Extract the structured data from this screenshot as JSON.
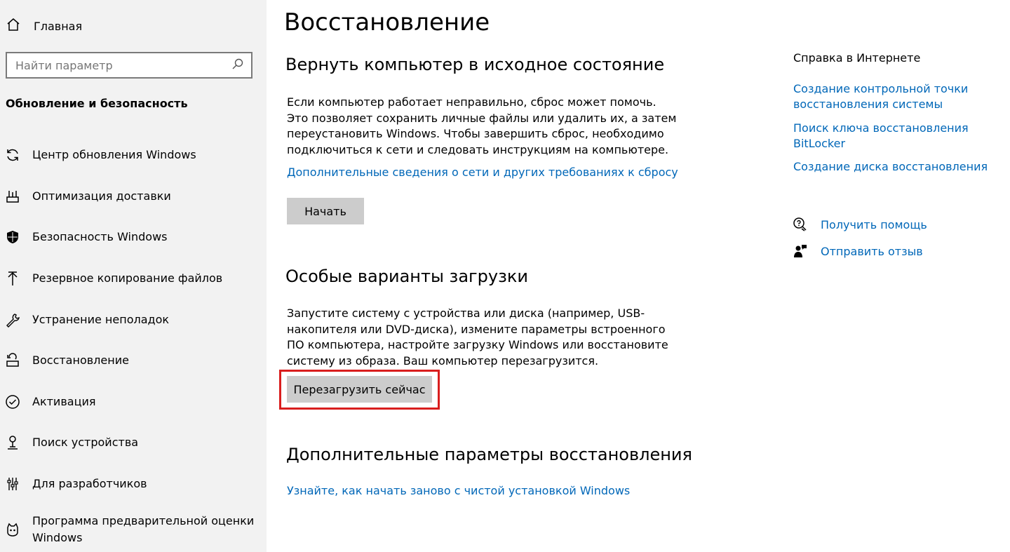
{
  "sidebar": {
    "home_label": "Главная",
    "search_placeholder": "Найти параметр",
    "section_title": "Обновление и безопасность",
    "items": [
      {
        "label": "Центр обновления Windows",
        "icon": "sync-icon"
      },
      {
        "label": "Оптимизация доставки",
        "icon": "delivery-icon"
      },
      {
        "label": "Безопасность Windows",
        "icon": "shield-icon"
      },
      {
        "label": "Резервное копирование файлов",
        "icon": "backup-arrow-icon"
      },
      {
        "label": "Устранение неполадок",
        "icon": "wrench-icon"
      },
      {
        "label": "Восстановление",
        "icon": "recovery-icon"
      },
      {
        "label": "Активация",
        "icon": "check-circle-icon"
      },
      {
        "label": "Поиск устройства",
        "icon": "person-pin-icon"
      },
      {
        "label": "Для разработчиков",
        "icon": "developer-icon"
      },
      {
        "label": "Программа предварительной оценки Windows",
        "icon": "insider-icon"
      }
    ]
  },
  "main": {
    "title": "Восстановление",
    "reset": {
      "heading": "Вернуть компьютер в исходное состояние",
      "description": "Если компьютер работает неправильно, сброс может помочь. Это позволяет сохранить личные файлы или удалить их, а затем переустановить Windows. Чтобы завершить сброс, необходимо подключиться к сети и следовать инструкциям на компьютере.",
      "link": "Дополнительные сведения о сети и других требованиях к сбросу",
      "button": "Начать"
    },
    "advanced_startup": {
      "heading": "Особые варианты загрузки",
      "description": "Запустите систему с устройства или диска (например, USB-накопителя или DVD-диска), измените параметры встроенного ПО компьютера, настройте загрузку Windows или восстановите систему из образа. Ваш компьютер перезагрузится.",
      "button": "Перезагрузить сейчас"
    },
    "more_options": {
      "heading": "Дополнительные параметры восстановления",
      "link": "Узнайте, как начать заново с чистой установкой Windows"
    }
  },
  "right": {
    "title": "Справка в Интернете",
    "links": [
      "Создание контрольной точки восстановления системы",
      "Поиск ключа восстановления BitLocker",
      "Создание диска восстановления"
    ],
    "get_help": "Получить помощь",
    "feedback": "Отправить отзыв"
  },
  "colors": {
    "link": "#0067b8",
    "sidebar_bg": "#f2f2f2",
    "button_bg": "#cccccc",
    "highlight": "#d91e1e"
  }
}
